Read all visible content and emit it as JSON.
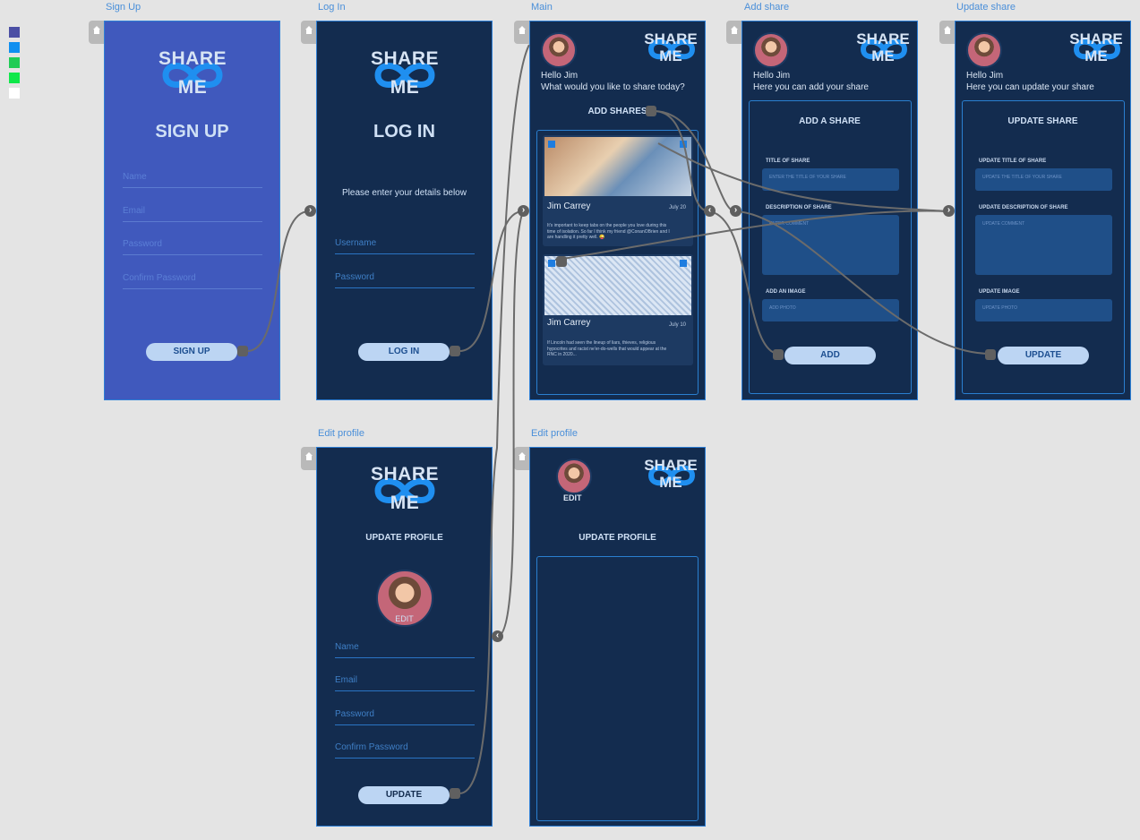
{
  "palette": [
    "#4b4fa4",
    "#0f8ff0",
    "#1fcc55",
    "#10e84a",
    "#ffffff"
  ],
  "artboards": {
    "signup": {
      "title": "Sign Up",
      "logo": {
        "line1": "SHARE",
        "line2": "ME"
      },
      "heading": "SIGN UP",
      "fields": [
        "Name",
        "Email",
        "Password",
        "Confirm Password"
      ],
      "button": "SIGN UP"
    },
    "login": {
      "title": "Log In",
      "logo": {
        "line1": "SHARE",
        "line2": "ME"
      },
      "heading": "LOG IN",
      "subtitle": "Please enter your details below",
      "fields": [
        "Username",
        "Password"
      ],
      "button": "LOG IN"
    },
    "main": {
      "title": "Main",
      "logo": {
        "line1": "SHARE",
        "line2": "ME"
      },
      "greeting": "Hello Jim",
      "prompt": "What would you like to share today?",
      "add_shares": "ADD SHARES",
      "cards": [
        {
          "name": "Jim Carrey",
          "date": "July 20",
          "text": "It's important to keep tabs on the people you love during this time of isolation. So far I think my friend @ConanOBrien and I are handling it pretty well. 😜"
        },
        {
          "name": "Jim Carrey",
          "date": "July 10",
          "text": "If Lincoln had seen the lineup of liars, thieves, religious hypocrites and racist ne'er-do-wells that would appear at the RNC in 2020..."
        }
      ]
    },
    "add_share": {
      "title": "Add share",
      "logo": {
        "line1": "SHARE",
        "line2": "ME"
      },
      "greeting": "Hello Jim",
      "prompt": "Here you can add your share",
      "heading": "ADD A SHARE",
      "title_label": "TITLE OF SHARE",
      "title_placeholder": "ENTER THE TITLE OF YOUR SHARE",
      "desc_label": "DESCRIPTION OF SHARE",
      "desc_placeholder": "ENTER COMMENT",
      "image_label": "ADD AN IMAGE",
      "image_placeholder": "ADD PHOTO",
      "button": "ADD"
    },
    "update_share": {
      "title": "Update share",
      "logo": {
        "line1": "SHARE",
        "line2": "ME"
      },
      "greeting": "Hello Jim",
      "prompt": "Here you can update your share",
      "heading": "UPDATE SHARE",
      "title_label": "UPDATE TITLE OF SHARE",
      "title_placeholder": "UPDATE THE TITLE OF YOUR SHARE",
      "desc_label": "UPDATE DESCRIPTION OF SHARE",
      "desc_placeholder": "UPDATE COMMENT",
      "image_label": "UPDATE IMAGE",
      "image_placeholder": "UPDATE PHOTO",
      "button": "UPDATE"
    },
    "edit_profile_a": {
      "title": "Edit profile",
      "logo": {
        "line1": "SHARE",
        "line2": "ME"
      },
      "heading": "UPDATE PROFILE",
      "edit": "EDIT",
      "fields": [
        "Name",
        "Email",
        "Password",
        "Confirm Password"
      ],
      "button": "UPDATE"
    },
    "edit_profile_b": {
      "title": "Edit profile",
      "logo": {
        "line1": "SHARE",
        "line2": "ME"
      },
      "edit": "EDIT",
      "heading": "UPDATE PROFILE"
    }
  }
}
